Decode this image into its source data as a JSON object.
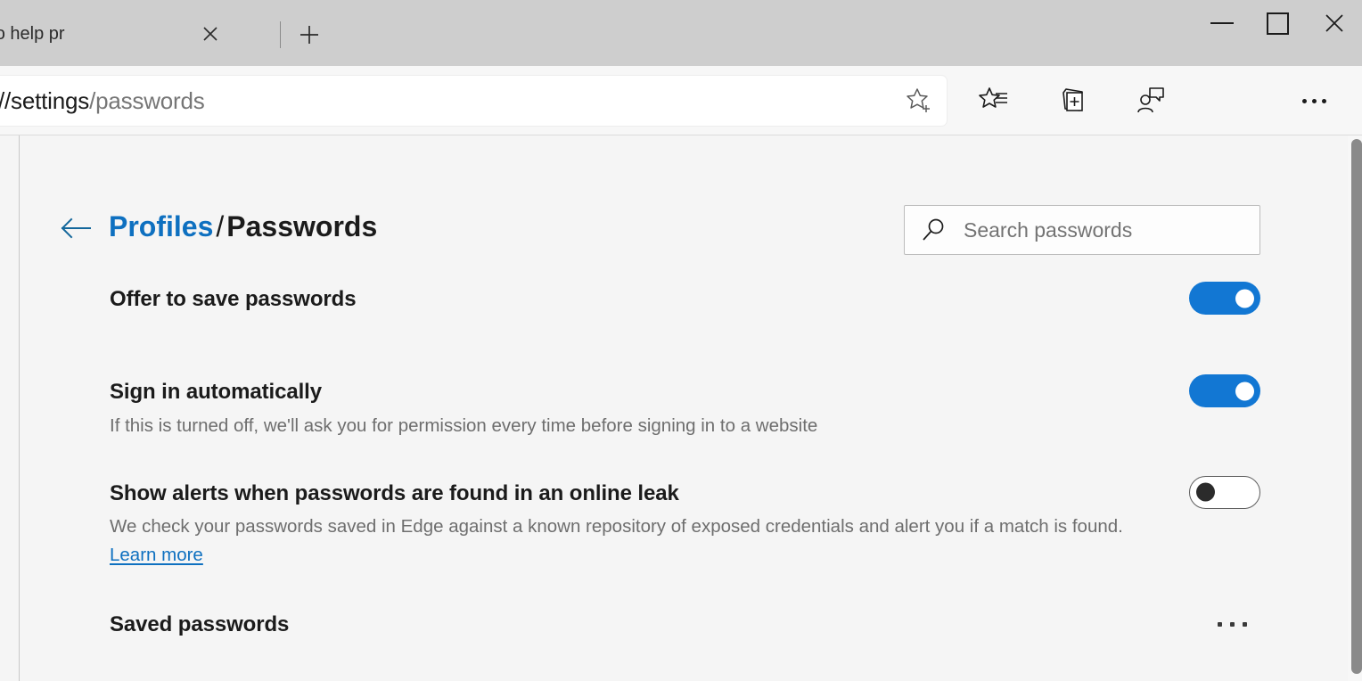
{
  "window": {
    "minimize_label": "Minimize",
    "maximize_label": "Maximize",
    "close_label": "Close"
  },
  "tabs": {
    "items": [
      {
        "title": "word Monitor to help pr",
        "close_label": "Close tab"
      }
    ],
    "new_tab_label": "New tab"
  },
  "omnibox": {
    "url_dark": "//settings",
    "url_light": "/passwords",
    "favorite_label": "Add this page to favorites"
  },
  "toolbar": {
    "favorites_label": "Favorites",
    "collections_label": "Collections",
    "profile_label": "Profile",
    "settings_label": "Settings and more"
  },
  "header": {
    "back_label": "Back",
    "breadcrumb_parent": "Profiles",
    "breadcrumb_separator": "/",
    "breadcrumb_current": "Passwords"
  },
  "search": {
    "placeholder": "Search passwords",
    "value": "",
    "icon": "search-icon"
  },
  "settings": {
    "offer_to_save": {
      "title": "Offer to save passwords",
      "toggle_state": "on"
    },
    "sign_in_automatically": {
      "title": "Sign in automatically",
      "description": "If this is turned off, we'll ask you for permission every time before signing in to a website",
      "toggle_state": "on"
    },
    "leak_alerts": {
      "title": "Show alerts when passwords are found in an online leak",
      "description": "We check your passwords saved in Edge against a known repository of exposed credentials and alert you if a match is found. ",
      "link_text": "Learn more",
      "toggle_state": "off"
    },
    "saved_passwords": {
      "title": "Saved passwords",
      "more_label": "More options"
    }
  },
  "colors": {
    "accent": "#1277d3",
    "link": "#0e70c0",
    "titlebar": "#cecece",
    "page_bg": "#f5f5f5"
  }
}
